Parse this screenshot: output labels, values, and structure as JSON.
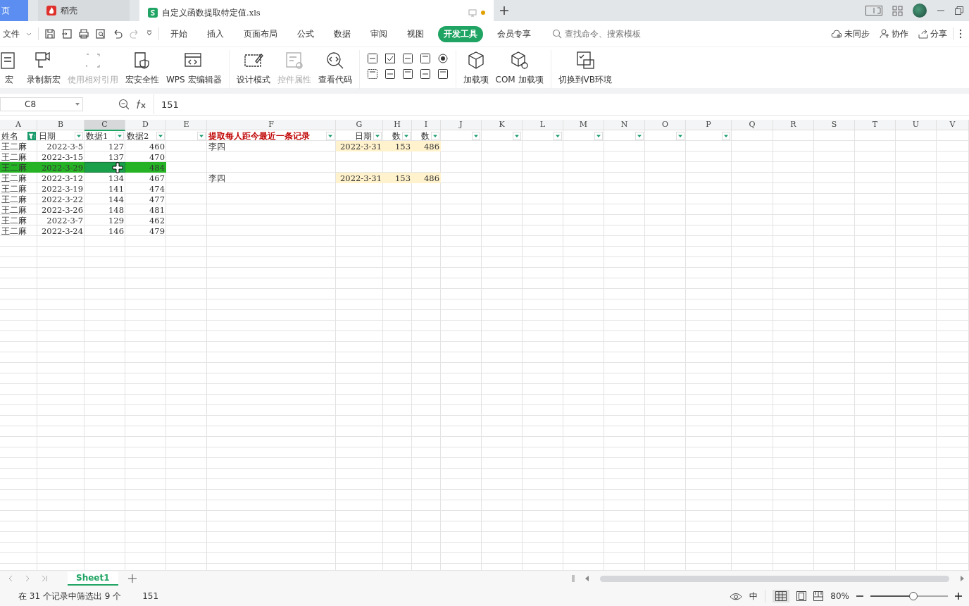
{
  "tabs": [
    {
      "label": "页",
      "kind": "home",
      "selected": false
    },
    {
      "label": "稻壳",
      "kind": "docer",
      "selected": false
    },
    {
      "label": "自定义函数提取特定值.xls",
      "kind": "sheet",
      "selected": true,
      "modified": true
    }
  ],
  "menu": {
    "file": "文件",
    "items": [
      {
        "label": "开始",
        "selected": false
      },
      {
        "label": "插入",
        "selected": false
      },
      {
        "label": "页面布局",
        "selected": false
      },
      {
        "label": "公式",
        "selected": false
      },
      {
        "label": "数据",
        "selected": false
      },
      {
        "label": "审阅",
        "selected": false
      },
      {
        "label": "视图",
        "selected": false
      },
      {
        "label": "开发工具",
        "selected": true
      },
      {
        "label": "会员专享",
        "selected": false
      }
    ],
    "search": {
      "placeholder": "查找命令、搜索模板"
    },
    "sync": "未同步",
    "collab": "协作",
    "share": "分享"
  },
  "ribbon": [
    {
      "label": "宏",
      "disabled": false,
      "kind": "macro"
    },
    {
      "label": "录制新宏",
      "disabled": false,
      "kind": "record"
    },
    {
      "label": "使用相对引用",
      "disabled": true,
      "kind": "relative"
    },
    {
      "label": "宏安全性",
      "disabled": false,
      "kind": "security"
    },
    {
      "label": "WPS 宏编辑器",
      "disabled": false,
      "kind": "editor"
    },
    {
      "label": "设计模式",
      "disabled": false,
      "kind": "design"
    },
    {
      "label": "控件属性",
      "disabled": true,
      "kind": "props"
    },
    {
      "label": "查看代码",
      "disabled": false,
      "kind": "code"
    },
    {
      "label": "加载项",
      "disabled": false,
      "kind": "addin"
    },
    {
      "label": "COM 加载项",
      "disabled": false,
      "kind": "com"
    },
    {
      "label": "切换到VB环境",
      "disabled": false,
      "kind": "vb"
    }
  ],
  "formula_bar": {
    "name_box": "C8",
    "value": "151"
  },
  "columns": [
    {
      "label": "A",
      "selected": false,
      "filtered": true,
      "header": {
        "text": "姓名"
      }
    },
    {
      "label": "B",
      "selected": false,
      "filtered": false,
      "header": {
        "text": "日期"
      }
    },
    {
      "label": "C",
      "selected": true,
      "filtered": false,
      "header": {
        "text": "数据1"
      }
    },
    {
      "label": "D",
      "selected": false,
      "filtered": false,
      "header": {
        "text": "数据2"
      }
    },
    {
      "label": "E",
      "selected": false,
      "filtered": false
    },
    {
      "label": "F",
      "selected": false,
      "filtered": false,
      "header": {
        "text": "提取每人距今最近一条记录",
        "kind": "title"
      }
    },
    {
      "label": "G",
      "selected": false,
      "filtered": false,
      "header": {
        "text": "日期"
      }
    },
    {
      "label": "H",
      "selected": false,
      "filtered": false,
      "header": {
        "text": "数"
      }
    },
    {
      "label": "I",
      "selected": false,
      "filtered": false,
      "header": {
        "text": "数"
      }
    },
    {
      "label": "J",
      "selected": false,
      "filtered": false
    },
    {
      "label": "K",
      "selected": false,
      "filtered": false
    },
    {
      "label": "L",
      "selected": false,
      "filtered": false
    },
    {
      "label": "M",
      "selected": false,
      "filtered": false
    },
    {
      "label": "N",
      "selected": false,
      "filtered": false
    },
    {
      "label": "O",
      "selected": false,
      "filtered": false
    },
    {
      "label": "P",
      "selected": false,
      "filtered": false
    },
    {
      "label": "Q",
      "selected": false
    },
    {
      "label": "R",
      "selected": false
    },
    {
      "label": "S",
      "selected": false
    },
    {
      "label": "T",
      "selected": false
    },
    {
      "label": "U",
      "selected": false
    },
    {
      "label": "V",
      "selected": false
    }
  ],
  "rows": [
    {
      "cells": {
        "A": "王二麻",
        "B": "2022-3-5",
        "C": "127",
        "D": "460",
        "F": "李四",
        "G": "2022-3-31",
        "H": "153",
        "I": "486"
      },
      "selected": false,
      "marked": true
    },
    {
      "cells": {
        "A": "王二麻",
        "B": "2022-3-15",
        "C": "137",
        "D": "470"
      },
      "selected": false,
      "marked": false
    },
    {
      "cells": {
        "A": "王二麻",
        "B": "2022-3-29",
        "C": {
          "active": true
        },
        "D": "484"
      },
      "selected": true,
      "marked": false
    },
    {
      "cells": {
        "A": "王二麻",
        "B": "2022-3-12",
        "C": "134",
        "D": "467",
        "F": "李四",
        "G": "2022-3-31",
        "H": "153",
        "I": "486"
      },
      "selected": false,
      "marked": true
    },
    {
      "cells": {
        "A": "王二麻",
        "B": "2022-3-19",
        "C": "141",
        "D": "474"
      },
      "selected": false,
      "marked": false
    },
    {
      "cells": {
        "A": "王二麻",
        "B": "2022-3-22",
        "C": "144",
        "D": "477"
      },
      "selected": false,
      "marked": false
    },
    {
      "cells": {
        "A": "王二麻",
        "B": "2022-3-26",
        "C": "148",
        "D": "481"
      },
      "selected": false,
      "marked": false
    },
    {
      "cells": {
        "A": "王二麻",
        "B": "2022-3-7",
        "C": "129",
        "D": "462"
      },
      "selected": false,
      "marked": false
    },
    {
      "cells": {
        "A": "王二麻",
        "B": "2022-3-24",
        "C": "146",
        "D": "479"
      },
      "selected": false,
      "marked": false
    }
  ],
  "sheets": [
    {
      "label": "Sheet1",
      "selected": true
    }
  ],
  "status_bar": {
    "filter_info": "在 31 个记录中筛选出 9 个",
    "value": "151",
    "input_mode": "中",
    "zoom": "80%",
    "zoom_level": {
      "level": 0.55
    }
  }
}
